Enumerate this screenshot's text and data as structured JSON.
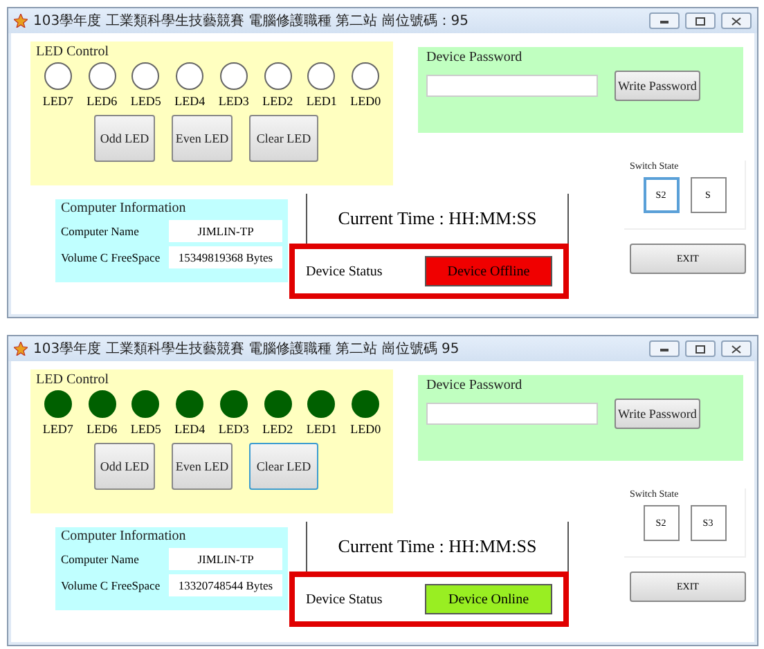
{
  "windows": [
    {
      "title": "103學年度 工業類科學生技藝競賽 電腦修護職種 第二站 崗位號碼：95",
      "led_control": {
        "title": "LED Control",
        "leds": [
          {
            "label": "LED7",
            "on": false
          },
          {
            "label": "LED6",
            "on": false
          },
          {
            "label": "LED5",
            "on": false
          },
          {
            "label": "LED4",
            "on": false
          },
          {
            "label": "LED3",
            "on": false
          },
          {
            "label": "LED2",
            "on": false
          },
          {
            "label": "LED1",
            "on": false
          },
          {
            "label": "LED0",
            "on": false
          }
        ],
        "buttons": [
          {
            "label": "Odd LED",
            "focused": false
          },
          {
            "label": "Even LED",
            "focused": false
          },
          {
            "label": "Clear LED",
            "focused": false
          }
        ]
      },
      "device_password": {
        "title": "Device Password",
        "button": "Write Password"
      },
      "computer_information": {
        "title": "Computer Information",
        "fields": [
          {
            "label": "Computer Name",
            "value": "JIMLIN-TP"
          },
          {
            "label": "Volume C FreeSpace",
            "value": "15349819368 Bytes"
          }
        ]
      },
      "current_time": "Current Time : HH:MM:SS",
      "device_status": {
        "label": "Device Status",
        "value": "Device Offline",
        "online": false
      },
      "switch_state": {
        "title": "Switch State",
        "switches": [
          {
            "label": "S2",
            "focused": true
          },
          {
            "label": "S",
            "focused": false
          }
        ]
      },
      "exit_button": "EXIT"
    },
    {
      "title": "103學年度 工業類科學生技藝競賽 電腦修護職種 第二站 崗位號碼 95",
      "led_control": {
        "title": "LED Control",
        "leds": [
          {
            "label": "LED7",
            "on": true
          },
          {
            "label": "LED6",
            "on": true
          },
          {
            "label": "LED5",
            "on": true
          },
          {
            "label": "LED4",
            "on": true
          },
          {
            "label": "LED3",
            "on": true
          },
          {
            "label": "LED2",
            "on": true
          },
          {
            "label": "LED1",
            "on": true
          },
          {
            "label": "LED0",
            "on": true
          }
        ],
        "buttons": [
          {
            "label": "Odd LED",
            "focused": false
          },
          {
            "label": "Even LED",
            "focused": false
          },
          {
            "label": "Clear LED",
            "focused": true
          }
        ]
      },
      "device_password": {
        "title": "Device Password",
        "button": "Write Password"
      },
      "computer_information": {
        "title": "Computer Information",
        "fields": [
          {
            "label": "Computer Name",
            "value": "JIMLIN-TP"
          },
          {
            "label": "Volume C FreeSpace",
            "value": "13320748544 Bytes"
          }
        ]
      },
      "current_time": "Current Time : HH:MM:SS",
      "device_status": {
        "label": "Device Status",
        "value": "Device Online",
        "online": true
      },
      "switch_state": {
        "title": "Switch State",
        "switches": [
          {
            "label": "S2",
            "focused": false
          },
          {
            "label": "S3",
            "focused": false
          }
        ]
      },
      "exit_button": "EXIT"
    }
  ]
}
